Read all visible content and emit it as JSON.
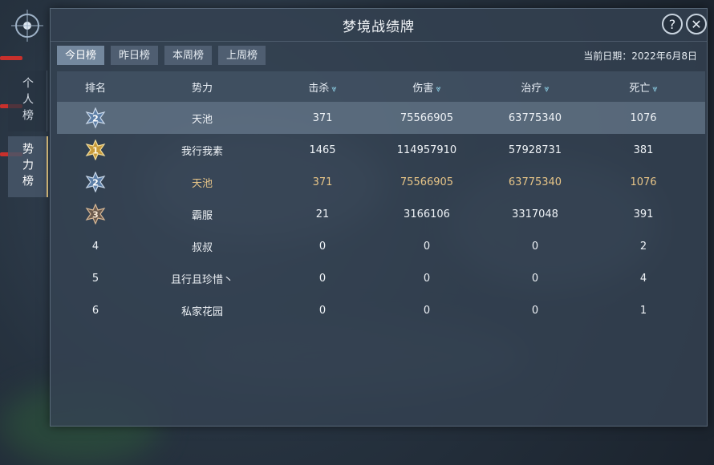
{
  "window": {
    "title": "梦境战绩牌"
  },
  "side_tabs": [
    {
      "label": "个人榜",
      "active": false
    },
    {
      "label": "势力榜",
      "active": true
    }
  ],
  "filters": [
    {
      "label": "今日榜",
      "active": true
    },
    {
      "label": "昨日榜",
      "active": false
    },
    {
      "label": "本周榜",
      "active": false
    },
    {
      "label": "上周榜",
      "active": false
    }
  ],
  "date_label": "当前日期：2022年6月8日",
  "table": {
    "headers": [
      "排名",
      "势力",
      "击杀",
      "伤害",
      "治疗",
      "死亡"
    ],
    "rows": [
      {
        "rank": "2",
        "badge": "silver",
        "faction": "天池",
        "kills": "371",
        "damage": "75566905",
        "healing": "63775340",
        "deaths": "1076",
        "style": "highlight"
      },
      {
        "rank": "1",
        "badge": "gold",
        "faction": "我行我素",
        "kills": "1465",
        "damage": "114957910",
        "healing": "57928731",
        "deaths": "381",
        "style": ""
      },
      {
        "rank": "2",
        "badge": "silver",
        "faction": "天池",
        "kills": "371",
        "damage": "75566905",
        "healing": "63775340",
        "deaths": "1076",
        "style": "gold"
      },
      {
        "rank": "3",
        "badge": "bronze",
        "faction": "霸服",
        "kills": "21",
        "damage": "3166106",
        "healing": "3317048",
        "deaths": "391",
        "style": ""
      },
      {
        "rank": "4",
        "badge": "",
        "faction": "叔叔",
        "kills": "0",
        "damage": "0",
        "healing": "0",
        "deaths": "2",
        "style": ""
      },
      {
        "rank": "5",
        "badge": "",
        "faction": "且行且珍惜丶",
        "kills": "0",
        "damage": "0",
        "healing": "0",
        "deaths": "4",
        "style": ""
      },
      {
        "rank": "6",
        "badge": "",
        "faction": "私家花园",
        "kills": "0",
        "damage": "0",
        "healing": "0",
        "deaths": "1",
        "style": ""
      }
    ]
  },
  "colors": {
    "gold_text": "#e6c487",
    "sort_icon": "#8fd3ea",
    "accent_red": "#c8302c"
  },
  "icons": {
    "help": "help-icon",
    "close": "close-icon",
    "sort": "sort-down-icon"
  }
}
